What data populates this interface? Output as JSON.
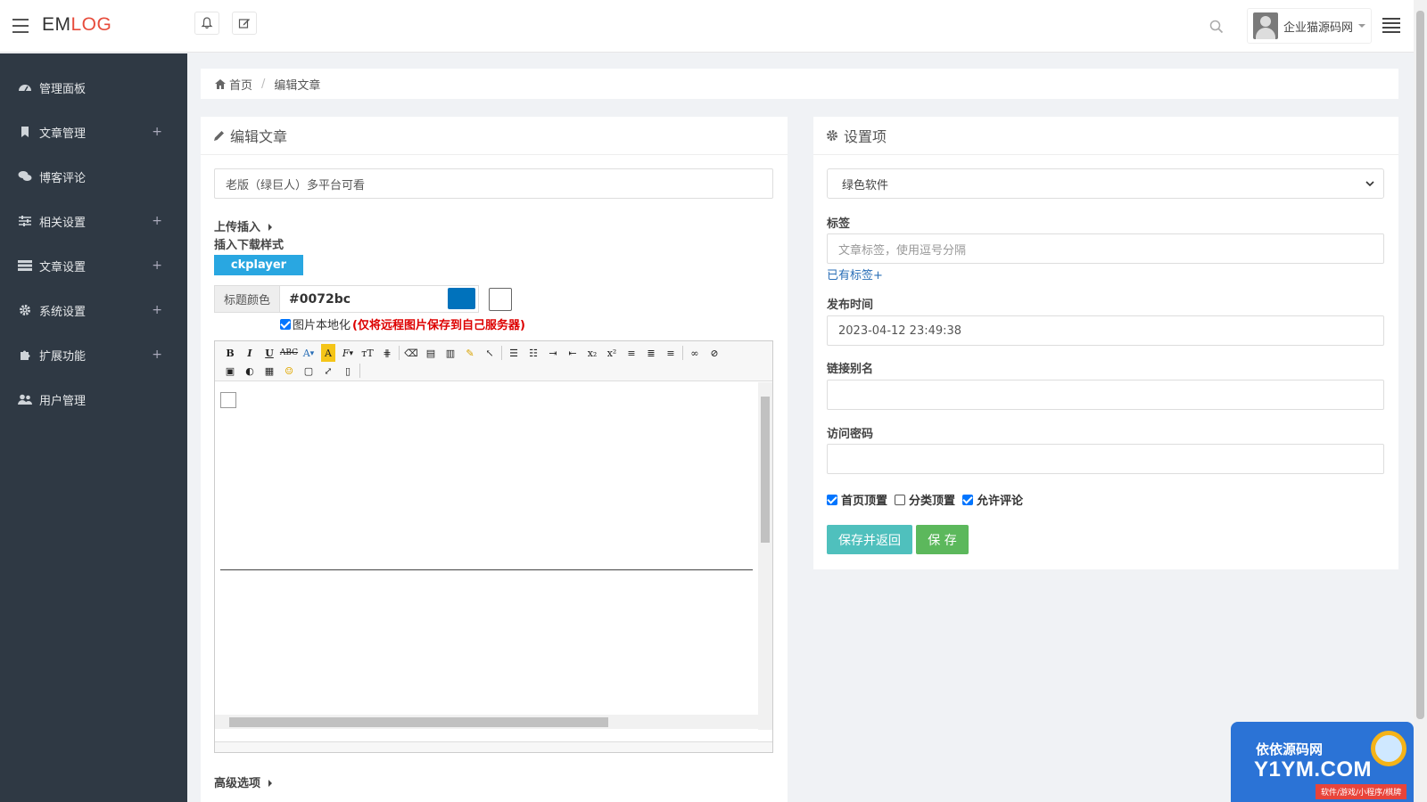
{
  "header": {
    "logo_em": "EM",
    "logo_log": "LOG",
    "user_name": "企业猫源码网"
  },
  "sidebar": {
    "items": [
      {
        "label": "管理面板",
        "icon": "dashboard-icon",
        "expandable": false
      },
      {
        "label": "文章管理",
        "icon": "bookmark-icon",
        "expandable": true
      },
      {
        "label": "博客评论",
        "icon": "comments-icon",
        "expandable": false
      },
      {
        "label": "相关设置",
        "icon": "sliders-icon",
        "expandable": true
      },
      {
        "label": "文章设置",
        "icon": "list-icon",
        "expandable": true
      },
      {
        "label": "系统设置",
        "icon": "gear-icon",
        "expandable": true
      },
      {
        "label": "扩展功能",
        "icon": "puzzle-icon",
        "expandable": true
      },
      {
        "label": "用户管理",
        "icon": "users-icon",
        "expandable": false
      }
    ],
    "plus": "+"
  },
  "breadcrumb": {
    "home": "首页",
    "sep": "/",
    "current": "编辑文章"
  },
  "editor_panel": {
    "title": "编辑文章",
    "post_title": "老版（绿巨人）多平台可看",
    "upload_insert": "上传插入",
    "download_style": "插入下载样式",
    "ckplayer": "ckplayer",
    "title_color_label": "标题颜色",
    "title_color_value": "#0072bc",
    "localize_label": "图片本地化",
    "localize_note": "(仅将远程图片保存到自己服务器)",
    "advanced": "高级选项"
  },
  "settings_panel": {
    "title": "设置项",
    "category": "绿色软件",
    "tags_label": "标签",
    "tags_placeholder": "文章标签，使用逗号分隔",
    "existing_tags": "已有标签+",
    "publish_time_label": "发布时间",
    "publish_time": "2023-04-12 23:49:38",
    "alias_label": "链接别名",
    "alias_value": "",
    "password_label": "访问密码",
    "password_value": "",
    "checks": [
      {
        "label": "首页顶置",
        "checked": true
      },
      {
        "label": "分类顶置",
        "checked": false
      },
      {
        "label": "允许评论",
        "checked": true
      }
    ],
    "save_return": "保存并返回",
    "save": "保 存"
  },
  "watermark": {
    "line1": "依依源码网",
    "line2": "Y1YM.COM",
    "line3": "软件/游戏/小程序/棋牌"
  },
  "colors": {
    "sidebar_bg": "#2f3944",
    "accent_blue": "#29a7e1",
    "title_color_swatch": "#0072bc",
    "btn_teal": "#4fc0bd",
    "btn_green": "#5cb85c",
    "logo_red": "#e74c3c"
  }
}
